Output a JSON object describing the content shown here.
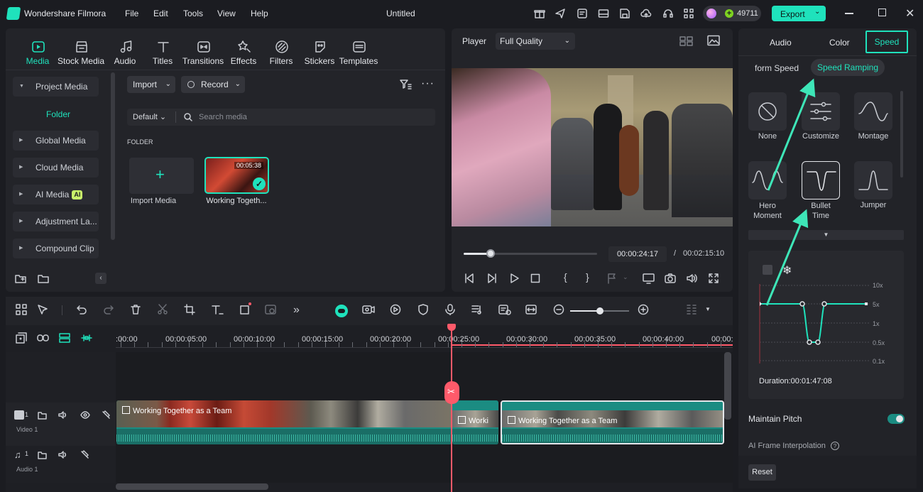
{
  "app": {
    "name": "Wondershare Filmora",
    "doc_title": "Untitled",
    "credits": "49711",
    "export_label": "Export"
  },
  "menu": [
    "File",
    "Edit",
    "Tools",
    "View",
    "Help"
  ],
  "media_tabs": [
    "Media",
    "Stock Media",
    "Audio",
    "Titles",
    "Transitions",
    "Effects",
    "Filters",
    "Stickers",
    "Templates"
  ],
  "sidebar": {
    "project_media": "Project Media",
    "folder": "Folder",
    "items": [
      "Global Media",
      "Cloud Media",
      "AI Media",
      "Adjustment La...",
      "Compound Clip"
    ],
    "ai_badge": "AI"
  },
  "media": {
    "import": "Import",
    "record": "Record",
    "sort": "Default",
    "search_placeholder": "Search media",
    "section": "FOLDER",
    "import_media": "Import Media",
    "clip_name": "Working Togeth...",
    "clip_duration": "00:05:38"
  },
  "player": {
    "label": "Player",
    "quality": "Full Quality",
    "current_time": "00:00:24:17",
    "separator": "/",
    "total_time": "00:02:15:10",
    "progress": 0.2
  },
  "right_panel": {
    "tabs": [
      "Audio",
      "Color",
      "Speed"
    ],
    "active_tab": "Speed",
    "subtabs": [
      "form Speed",
      "Speed Ramping"
    ],
    "presets": [
      {
        "name": "None",
        "label": "None"
      },
      {
        "name": "Customize",
        "label": "Customize"
      },
      {
        "name": "Montage",
        "label": "Montage"
      },
      {
        "name": "Hero Moment",
        "line1": "Hero",
        "line2": "Moment"
      },
      {
        "name": "Bullet Time",
        "line1": "Bullet",
        "line2": "Time"
      },
      {
        "name": "Jumper",
        "label": "Jumper"
      }
    ],
    "graph_scale": [
      "10x",
      "5x",
      "1x",
      "0.5x",
      "0.1x"
    ],
    "duration": "Duration:00:01:47:08",
    "maintain_pitch": "Maintain Pitch",
    "ai_interp": "AI Frame Interpolation",
    "reset": "Reset"
  },
  "timeline": {
    "ruler": [
      ":00:00",
      "00:00:05:00",
      "00:00:10:00",
      "00:00:15:00",
      "00:00:20:00",
      "00:00:25:00",
      "00:00:30:00",
      "00:00:35:00",
      "00:00:40:00",
      "00:00:"
    ],
    "video_track": "Video 1",
    "audio_track": "Audio 1",
    "track_num": "1",
    "clip1_label": "Working Together as a Team",
    "clip2_label": "Worki",
    "clip3_label": "Working Together as a Team"
  },
  "colors": {
    "accent": "#1fe2bc",
    "playhead": "#ff5a6a",
    "export": "#1fe2bc",
    "clip": "#1b8c82"
  }
}
